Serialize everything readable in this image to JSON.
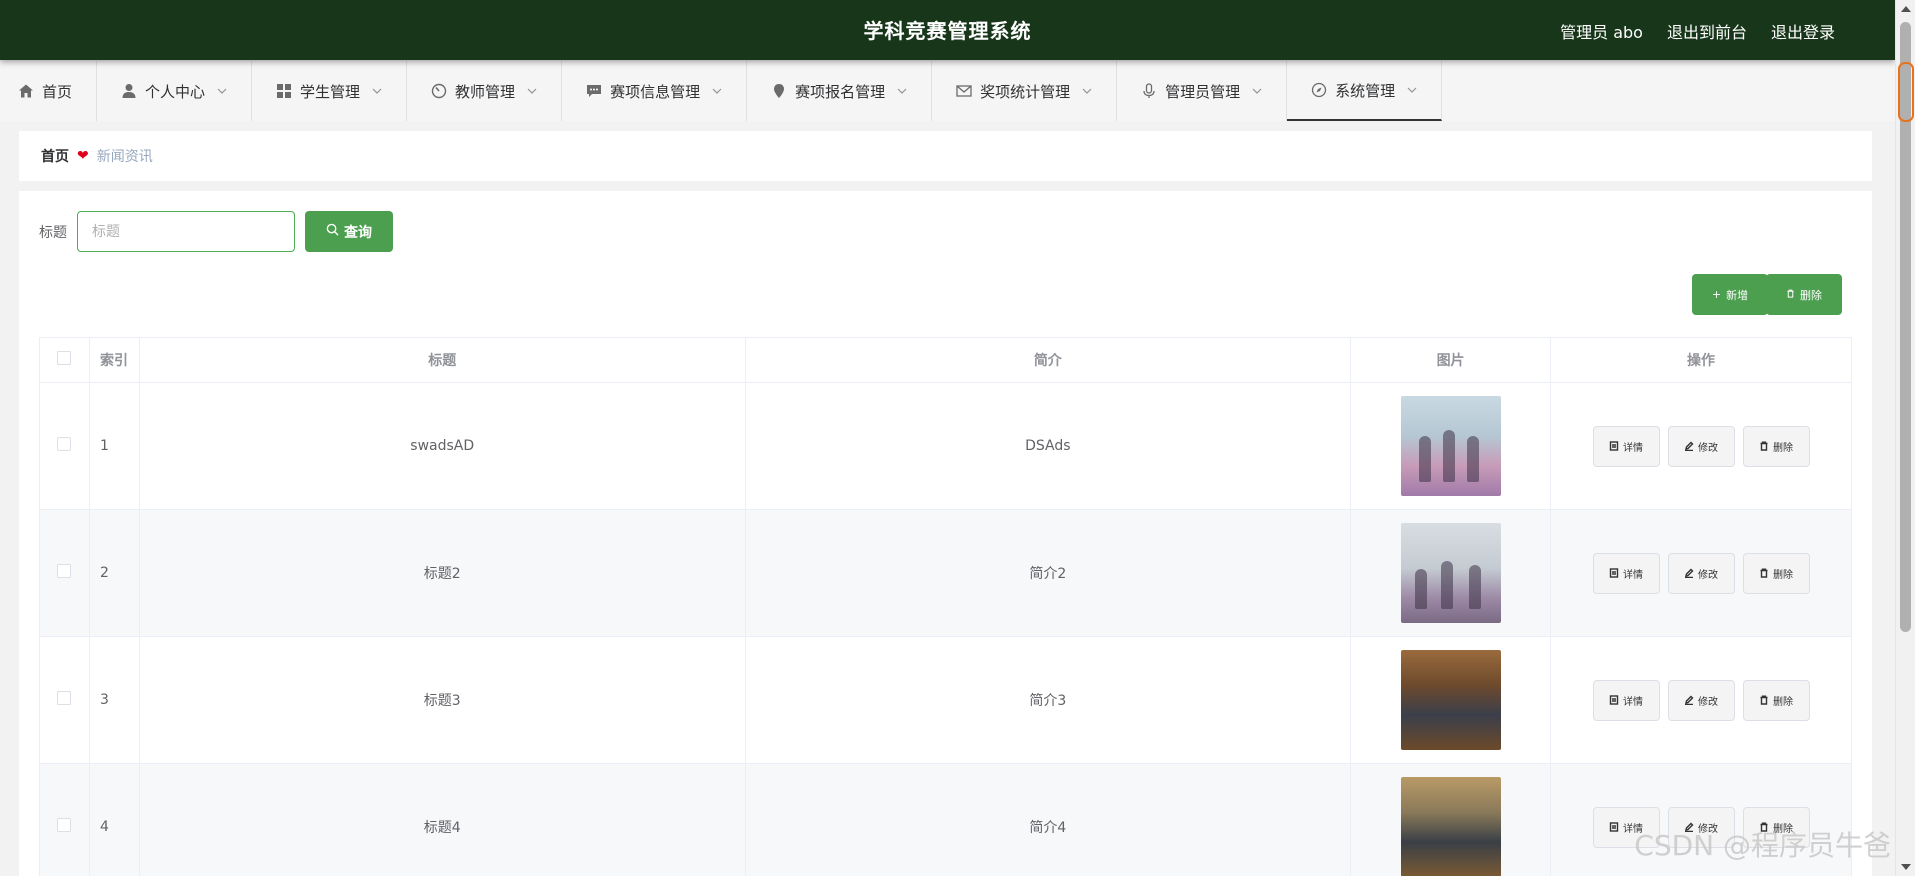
{
  "header": {
    "title": "学科竞赛管理系统",
    "user": "管理员 abo",
    "back_to_front": "退出到前台",
    "logout": "退出登录"
  },
  "nav": {
    "items": [
      {
        "label": "首页",
        "icon": "home-icon"
      },
      {
        "label": "个人中心",
        "icon": "user-icon"
      },
      {
        "label": "学生管理",
        "icon": "grid-icon"
      },
      {
        "label": "教师管理",
        "icon": "speedometer-icon"
      },
      {
        "label": "赛项信息管理",
        "icon": "chat-icon"
      },
      {
        "label": "赛项报名管理",
        "icon": "location-icon"
      },
      {
        "label": "奖项统计管理",
        "icon": "mail-icon"
      },
      {
        "label": "管理员管理",
        "icon": "microphone-icon"
      },
      {
        "label": "系统管理",
        "icon": "compass-icon"
      }
    ]
  },
  "breadcrumb": {
    "home": "首页",
    "current": "新闻资讯"
  },
  "search": {
    "label": "标题",
    "placeholder": "标题",
    "button": "查询"
  },
  "toolbar": {
    "add": "新增",
    "delete": "删除"
  },
  "table": {
    "headers": [
      "索引",
      "标题",
      "简介",
      "图片",
      "操作"
    ],
    "rows": [
      {
        "index": "1",
        "title": "swadsAD",
        "intro": "DSAds"
      },
      {
        "index": "2",
        "title": "标题2",
        "intro": "简介2"
      },
      {
        "index": "3",
        "title": "标题3",
        "intro": "简介3"
      },
      {
        "index": "4",
        "title": "标题4",
        "intro": "简介4"
      }
    ],
    "actions": {
      "detail": "详情",
      "edit": "修改",
      "delete": "删除"
    }
  },
  "watermark": "CSDN @程序员牛爸",
  "colors": {
    "header_bg": "#17361a",
    "accent": "#4b9f4f",
    "heart": "#e0021a"
  }
}
